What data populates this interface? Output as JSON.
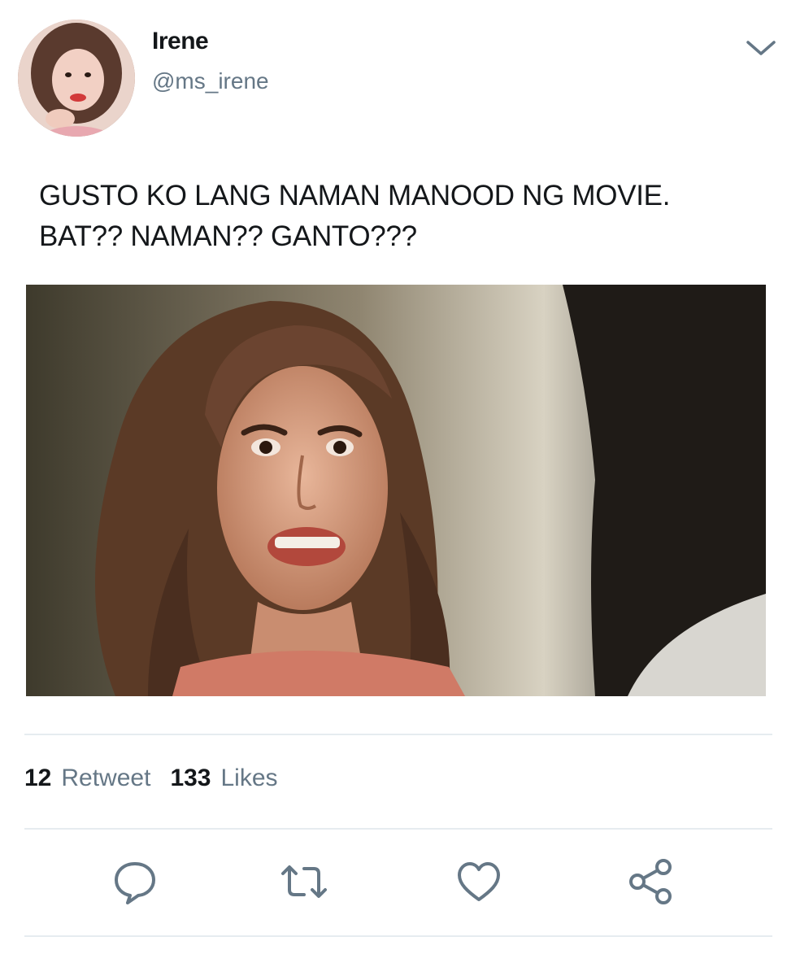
{
  "user": {
    "display_name": "Irene",
    "handle": "@ms_irene",
    "avatar_icon": "profile-photo"
  },
  "header": {
    "menu_icon": "chevron-down-icon"
  },
  "tweet": {
    "text_lines": [
      "GUSTO KO LANG NAMAN MANOOD NG MOVIE.",
      "BAT?? NAMAN?? GANTO???"
    ],
    "media": "movie-still-woman-shouting"
  },
  "stats": {
    "retweets_count": "12",
    "retweets_label": "Retweet",
    "likes_count": "133",
    "likes_label": "Likes"
  },
  "actions": [
    "reply-icon",
    "retweet-icon",
    "like-icon",
    "share-icon"
  ],
  "colors": {
    "text": "#14171a",
    "secondary_text": "#657786",
    "icon": "#657786",
    "divider": "#e6ecf0"
  }
}
